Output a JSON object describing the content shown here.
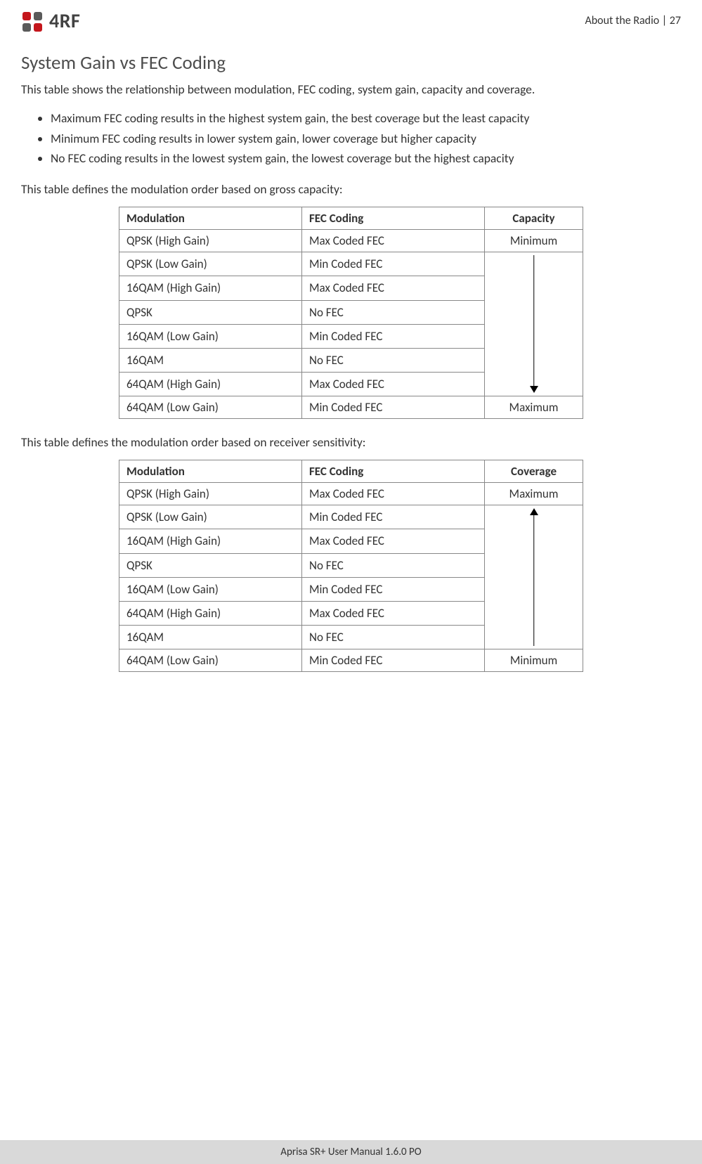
{
  "header": {
    "logo_text": "4RF",
    "page_label": "About the Radio  |  27"
  },
  "section": {
    "heading": "System Gain vs FEC Coding",
    "intro": "This table shows the relationship between modulation, FEC coding, system gain, capacity and coverage.",
    "bullets": [
      "Maximum FEC coding results in the highest system gain, the best coverage but the least capacity",
      "Minimum FEC coding results in lower system gain, lower coverage but higher capacity",
      "No FEC coding results in the lowest system gain, the lowest coverage but the highest capacity"
    ],
    "table1_intro": "This table defines the modulation order based on gross capacity:",
    "table2_intro": "This table defines the modulation order based on receiver sensitivity:"
  },
  "table1": {
    "headers": [
      "Modulation",
      "FEC Coding",
      "Capacity"
    ],
    "rows": [
      {
        "modulation": "QPSK (High Gain)",
        "fec": "Max Coded FEC",
        "cap": "Minimum"
      },
      {
        "modulation": "QPSK (Low Gain)",
        "fec": "Min Coded FEC",
        "cap": ""
      },
      {
        "modulation": "16QAM (High Gain)",
        "fec": "Max Coded FEC",
        "cap": ""
      },
      {
        "modulation": "QPSK",
        "fec": "No FEC",
        "cap": ""
      },
      {
        "modulation": "16QAM (Low Gain)",
        "fec": "Min Coded FEC",
        "cap": ""
      },
      {
        "modulation": "16QAM",
        "fec": "No FEC",
        "cap": ""
      },
      {
        "modulation": "64QAM (High Gain)",
        "fec": "Max Coded FEC",
        "cap": ""
      },
      {
        "modulation": "64QAM (Low Gain)",
        "fec": "Min Coded FEC",
        "cap": "Maximum"
      }
    ],
    "arrow_direction": "down"
  },
  "table2": {
    "headers": [
      "Modulation",
      "FEC Coding",
      "Coverage"
    ],
    "rows": [
      {
        "modulation": "QPSK (High Gain)",
        "fec": "Max Coded FEC",
        "cap": "Maximum"
      },
      {
        "modulation": "QPSK (Low Gain)",
        "fec": "Min Coded FEC",
        "cap": ""
      },
      {
        "modulation": "16QAM (High Gain)",
        "fec": "Max Coded FEC",
        "cap": ""
      },
      {
        "modulation": "QPSK",
        "fec": "No FEC",
        "cap": ""
      },
      {
        "modulation": "16QAM (Low Gain)",
        "fec": "Min Coded FEC",
        "cap": ""
      },
      {
        "modulation": "64QAM (High Gain)",
        "fec": "Max Coded FEC",
        "cap": ""
      },
      {
        "modulation": "16QAM",
        "fec": "No FEC",
        "cap": ""
      },
      {
        "modulation": "64QAM (Low Gain)",
        "fec": "Min Coded FEC",
        "cap": "Minimum"
      }
    ],
    "arrow_direction": "up"
  },
  "footer": {
    "text": "Aprisa SR+ User Manual 1.6.0 PO"
  }
}
